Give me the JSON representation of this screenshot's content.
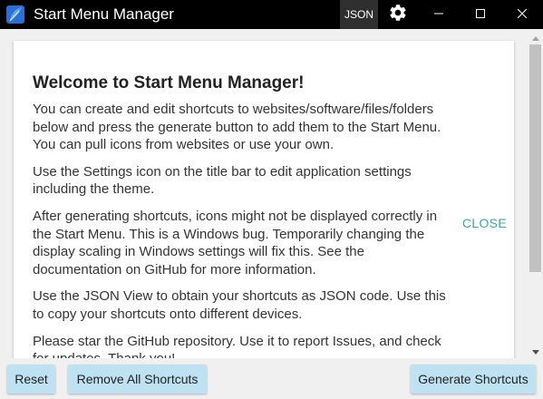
{
  "window": {
    "title": "Start Menu Manager",
    "json_label": "JSON",
    "icons": {
      "app": "app-logo-icon",
      "settings": "gear-icon",
      "minimize": "minimize-icon",
      "maximize": "maximize-icon",
      "close": "close-icon"
    }
  },
  "welcome": {
    "title": "Welcome to Start Menu Manager!",
    "paragraphs": [
      "You can create and edit shortcuts to websites/software/files/folders below and press the generate button to add them to the Start Menu. You can pull icons from websites or use your own.",
      "Use the Settings icon on the title bar to edit application settings including the theme.",
      "After generating shortcuts, icons might not be displayed correctly in the Start Menu. This is a Windows bug. Temporarily changing the display scaling in Windows settings will fix this. See the documentation on GitHub for more information.",
      "Use the JSON View to obtain your shortcuts as JSON code. Use this to copy your shortcuts onto different devices.",
      "Please star the GitHub repository. Use it to report Issues, and check for updates. Thank you!"
    ],
    "close_label": "CLOSE"
  },
  "toolbar": {
    "reset_label": "Reset",
    "remove_all_label": "Remove All Shortcuts",
    "generate_label": "Generate Shortcuts"
  },
  "colors": {
    "titlebar": "#000000",
    "button_bg": "#bfe2f2",
    "close_link": "#33a8ad",
    "card_bg": "#ffffff",
    "window_bg": "#f0f0f0"
  }
}
